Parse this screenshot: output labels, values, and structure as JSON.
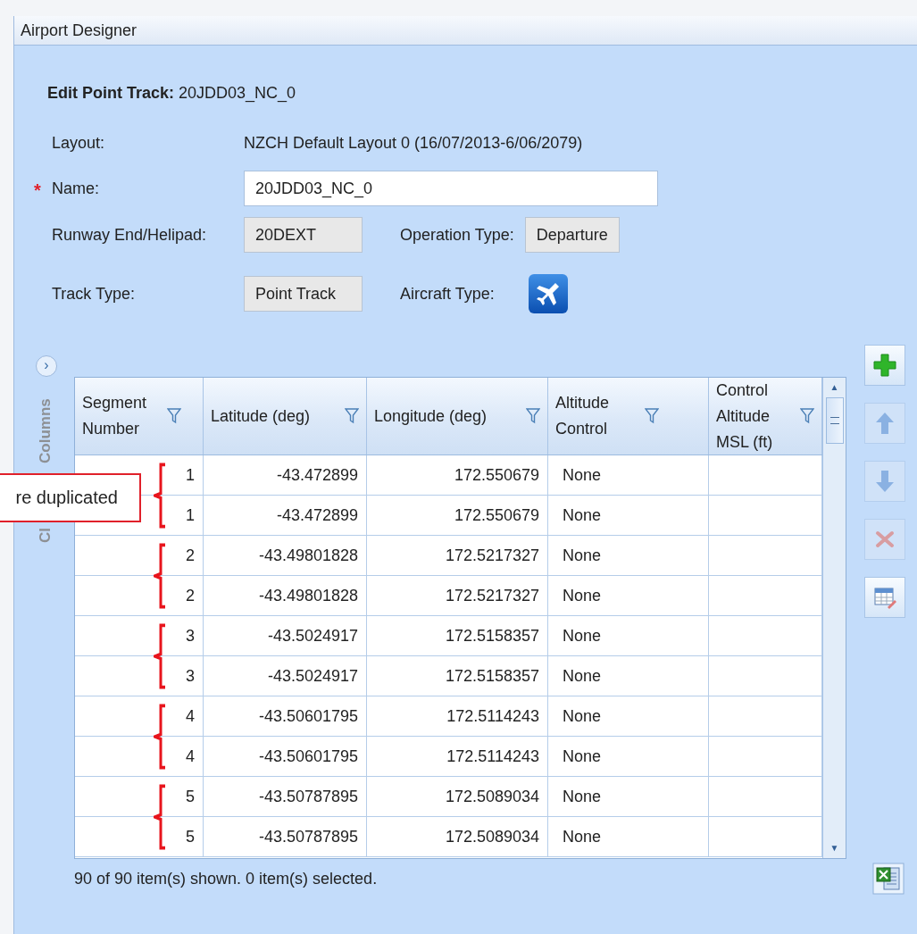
{
  "window": {
    "title": "Airport Designer"
  },
  "heading": {
    "label": "Edit Point Track:",
    "value": "20JDD03_NC_0"
  },
  "form": {
    "layout_label": "Layout:",
    "layout_value": "NZCH Default Layout 0 (16/07/2013-6/06/2079)",
    "name_label": "Name:",
    "name_required": true,
    "required_mark": "*",
    "name_value": "20JDD03_NC_0",
    "runway_label": "Runway End/Helipad:",
    "runway_value": "20DEXT",
    "operation_label": "Operation Type:",
    "operation_value": "Departure",
    "track_label": "Track Type:",
    "track_value": "Point Track",
    "aircraft_label": "Aircraft Type:"
  },
  "side_panel": {
    "expand_glyph": "›",
    "label": "Columns",
    "cut_label": "Cl"
  },
  "scrollbar": {
    "up_glyph": "▲",
    "down_glyph": "▼"
  },
  "table": {
    "columns": [
      "Segment Number",
      "Latitude (deg)",
      "Longitude (deg)",
      "Altitude Control",
      "Control Altitude MSL (ft)"
    ],
    "groups": [
      {
        "rows": [
          [
            "1",
            "-43.472899",
            "172.550679",
            "None",
            ""
          ],
          [
            "1",
            "-43.472899",
            "172.550679",
            "None",
            ""
          ]
        ]
      },
      {
        "rows": [
          [
            "2",
            "-43.49801828",
            "172.5217327",
            "None",
            ""
          ],
          [
            "2",
            "-43.49801828",
            "172.5217327",
            "None",
            ""
          ]
        ]
      },
      {
        "rows": [
          [
            "3",
            "-43.5024917",
            "172.5158357",
            "None",
            ""
          ],
          [
            "3",
            "-43.5024917",
            "172.5158357",
            "None",
            ""
          ]
        ]
      },
      {
        "rows": [
          [
            "4",
            "-43.50601795",
            "172.5114243",
            "None",
            ""
          ],
          [
            "4",
            "-43.50601795",
            "172.5114243",
            "None",
            ""
          ]
        ]
      },
      {
        "rows": [
          [
            "5",
            "-43.50787895",
            "172.5089034",
            "None",
            ""
          ],
          [
            "5",
            "-43.50787895",
            "172.5089034",
            "None",
            ""
          ]
        ]
      }
    ]
  },
  "toolbar": [
    {
      "kind": "add",
      "disabled": false
    },
    {
      "kind": "up",
      "disabled": true
    },
    {
      "kind": "down",
      "disabled": true
    },
    {
      "kind": "delete",
      "disabled": true
    },
    {
      "kind": "edit",
      "disabled": false
    }
  ],
  "callout": {
    "text": "re duplicated"
  },
  "status_bar": {
    "text": "90 of 90 item(s) shown. 0 item(s) selected."
  }
}
